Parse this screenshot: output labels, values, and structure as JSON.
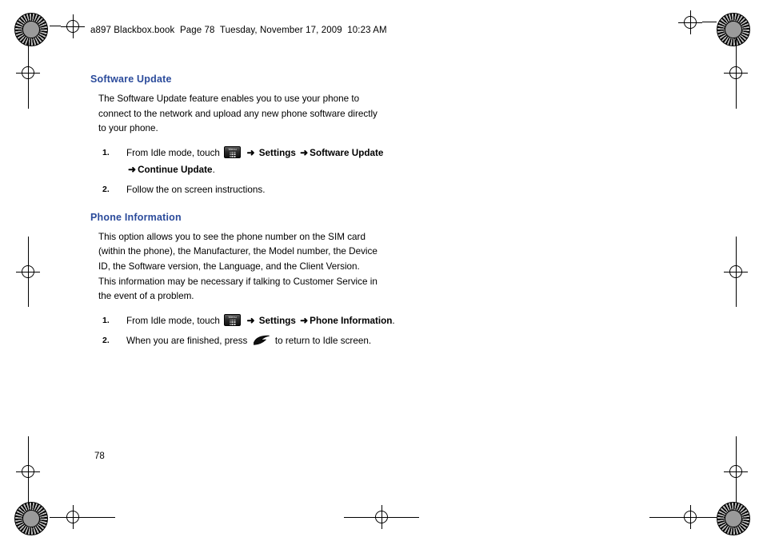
{
  "document": {
    "header": "a897 Blackbox.book  Page 78  Tuesday, November 17, 2009  10:23 AM",
    "page_number": "78",
    "sections": [
      {
        "heading": "Software Update",
        "paragraph": "The Software Update feature enables you to use your phone to connect to the network and upload any new phone software directly to your phone.",
        "steps": [
          {
            "num": "1.",
            "pre": "From Idle mode, touch",
            "icon": "menu-key-icon",
            "arrow1": "➜",
            "bold1": "Settings",
            "arrow2": "➜",
            "bold2": "Software Update",
            "arrow3": "➜",
            "bold3": "Continue Update",
            "post": "."
          },
          {
            "num": "2.",
            "text": "Follow the on screen instructions."
          }
        ]
      },
      {
        "heading": "Phone Information",
        "paragraph": "This option allows you to see the phone number on the SIM card (within the phone), the Manufacturer, the Model number, the Device ID, the Software version, the Language, and the Client Version. This information may be necessary if talking to Customer Service in the event of a problem.",
        "steps": [
          {
            "num": "1.",
            "pre": "From Idle mode, touch",
            "icon": "menu-key-icon",
            "arrow1": "➜",
            "bold1": "Settings",
            "arrow2": "➜",
            "bold2": "Phone Information",
            "post": "."
          },
          {
            "num": "2.",
            "pre": "When you are finished, press",
            "icon": "end-call-key-icon",
            "post": "to return to Idle screen."
          }
        ]
      }
    ],
    "glyphs": {
      "menu_key_caption": "Menu"
    },
    "colors": {
      "heading": "#2b4b9b",
      "body_text": "#000000"
    }
  }
}
